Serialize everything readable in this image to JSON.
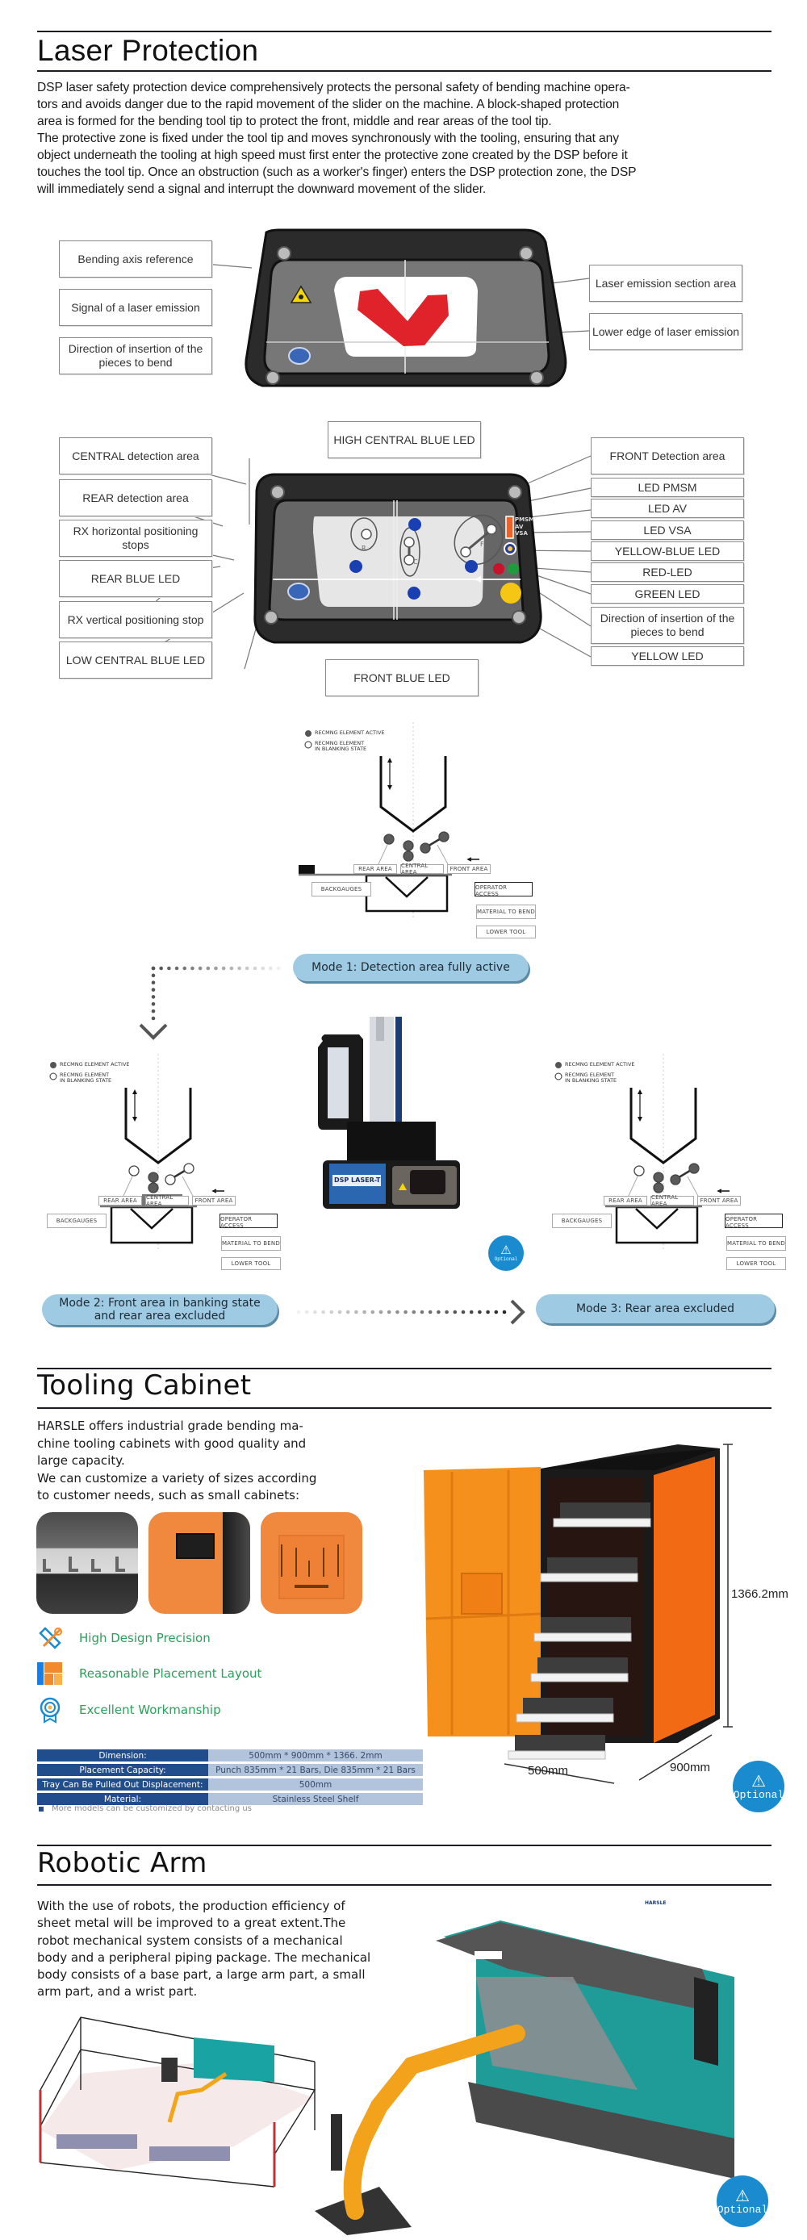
{
  "laser_protection": {
    "title": "Laser Protection",
    "paragraph_lines": [
      "DSP laser safety protection device comprehensively protects the personal safety of bending machine opera-",
      "tors and avoids danger due to the rapid movement of the slider on the machine. A block-shaped protection",
      "area is formed for the bending tool tip to protect the front, middle and rear areas of the tool tip.",
      "The protective zone is fixed under the tool tip and moves synchronously with the tooling, ensuring that any",
      "object underneath the tooling at high speed must first enter the protective zone created by the DSP before it",
      "touches the tool tip. Once an obstruction (such as a worker's finger) enters the DSP protection zone, the DSP",
      "will immediately send a signal and interrupt the downward movement of the slider."
    ],
    "diagram1": {
      "callouts_left": [
        "Bending axis reference",
        "Signal of a laser emission",
        "Direction of insertion of the pieces to bend"
      ],
      "callouts_right": [
        "Laser emission section area",
        "Lower edge of laser emission"
      ]
    },
    "diagram2": {
      "callouts_top": "HIGH CENTRAL BLUE LED",
      "callouts_bottom": "FRONT BLUE LED",
      "callouts_left": [
        "CENTRAL detection area",
        "REAR detection area",
        "RX horizontal positioning stops",
        "REAR BLUE LED",
        "RX vertical positioning stop",
        "LOW CENTRAL BLUE LED"
      ],
      "callouts_right": [
        "FRONT Detection area",
        "LED PMSM",
        "LED AV",
        "LED VSA",
        "YELLOW-BLUE LED",
        "RED-LED",
        "GREEN LED",
        "Direction of insertion of the pieces to bend",
        "YELLOW LED"
      ],
      "panel_labels": {
        "pmsm": "PMSM",
        "av": "AV",
        "vsa": "VSA",
        "r": "R",
        "c": "C",
        "f": "F"
      }
    },
    "mode_diagram": {
      "legend_active": "RECMNG ELEMENT ACTIVE",
      "legend_blanking_1": "RECMNG ELEMENT",
      "legend_blanking_2": "IN BLANKING STATE",
      "rear_area": "REAR AREA",
      "central_area": "CENTRAL AREA",
      "front_area": "FRONT AREA",
      "backgauges": "BACKGAUGES",
      "operator_access": "OPERATOR ACCESS",
      "material_to_bend": "MATERIAL TO BEND",
      "lower_tool": "LOWER TOOL"
    },
    "modes": [
      {
        "label": "Mode 1: Detection area fully active"
      },
      {
        "label": "Mode 2: Front area in banking state and rear area excluded"
      },
      {
        "label": "Mode 3: Rear area excluded"
      }
    ],
    "device_label": "DSP LASER-T",
    "optional_badge": "Optional"
  },
  "tooling_cabinet": {
    "title": "Tooling Cabinet",
    "paragraph_lines": [
      "HARSLE offers industrial grade bending ma-",
      "chine tooling cabinets with good quality and",
      "large capacity.",
      "We can customize a variety of sizes according",
      "to customer needs, such as small cabinets:"
    ],
    "features": [
      {
        "icon": "tools-icon",
        "label": "High Design Precision"
      },
      {
        "icon": "layout-icon",
        "label": "Reasonable Placement Layout"
      },
      {
        "icon": "award-icon",
        "label": "Excellent Workmanship"
      }
    ],
    "specs": [
      {
        "key": "Dimension:",
        "value": "500mm * 900mm * 1366. 2mm"
      },
      {
        "key": "Placement Capacity:",
        "value": "Punch 835mm * 21 Bars, Die 835mm * 21 Bars"
      },
      {
        "key": "Tray Can Be Pulled Out Displacement:",
        "value": "500mm"
      },
      {
        "key": "Material:",
        "value": "Stainless Steel Shelf"
      }
    ],
    "note": "More models can be customized by contacting us",
    "dimensions": {
      "height": "1366.2mm",
      "width": "500mm",
      "depth": "900mm"
    },
    "optional_badge": "Optional"
  },
  "robotic_arm": {
    "title": "Robotic Arm",
    "paragraph_lines": [
      "With the use of robots, the production efficiency of",
      "sheet metal will be improved to a great extent.The",
      "robot mechanical system consists of a mechanical",
      "body and a peripheral piping package. The mechanical",
      "body consists of a base part, a large arm part, a small",
      "arm part, and a wrist part."
    ],
    "brand_label": "HARSLE",
    "optional_badge": "Optional"
  }
}
